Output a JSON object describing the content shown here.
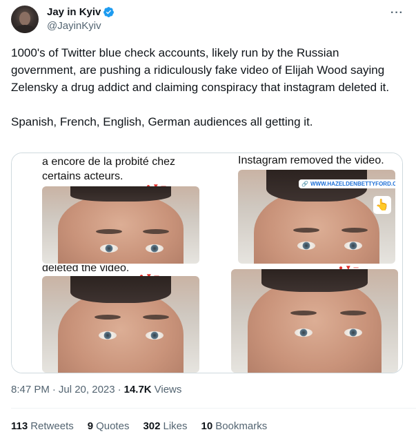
{
  "author": {
    "display_name": "Jay in Kyiv",
    "handle": "@JayinKyiv",
    "verified_icon": "verified-badge-icon",
    "more_label": "···"
  },
  "tweet": {
    "text": "1000's of Twitter blue check accounts, likely run by the Russian government, are pushing a ridiculously fake video of Elijah Wood saying Zelensky a drug addict and claiming conspiracy that instagram deleted it.\n\nSpanish, French, English, German audiences all getting it."
  },
  "media": {
    "panels": [
      {
        "caption": "a encore de la probité chez\ncertains acteurs."
      },
      {
        "caption": "Instagram removed the video.",
        "link_text": "WWW.HAZELDENBETTYFORD.ORG"
      },
      {
        "caption": "deleted the video."
      },
      {
        "caption": ""
      }
    ]
  },
  "meta": {
    "time": "8:47 PM",
    "separator": "·",
    "date": "Jul 20, 2023",
    "views_count": "14.7K",
    "views_label": "Views"
  },
  "stats": [
    {
      "num": "113",
      "label": "Retweets"
    },
    {
      "num": "9",
      "label": "Quotes"
    },
    {
      "num": "302",
      "label": "Likes"
    },
    {
      "num": "10",
      "label": "Bookmarks"
    }
  ],
  "colors": {
    "verified": "#1d9bf0",
    "secondary_text": "#536471",
    "primary_text": "#0f1419",
    "border": "#cfd9de"
  }
}
